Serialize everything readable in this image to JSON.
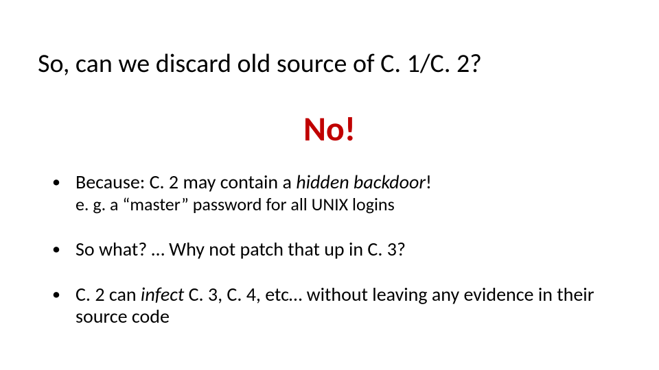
{
  "slide": {
    "title": "So, can we discard old source of C. 1/C. 2?",
    "no_text": "No!",
    "bullets": {
      "b1_lead": "Because: C. 2 may contain a ",
      "b1_em": "hidden backdoor",
      "b1_tail": "!",
      "b1_sub": "e. g. a “master” password for all UNIX logins",
      "b2": "So what? … Why not patch that up in C. 3?",
      "b3_lead": "C. 2 can ",
      "b3_em": "infect",
      "b3_tail": " C. 3, C. 4, etc… without leaving any evidence in their source code"
    }
  }
}
